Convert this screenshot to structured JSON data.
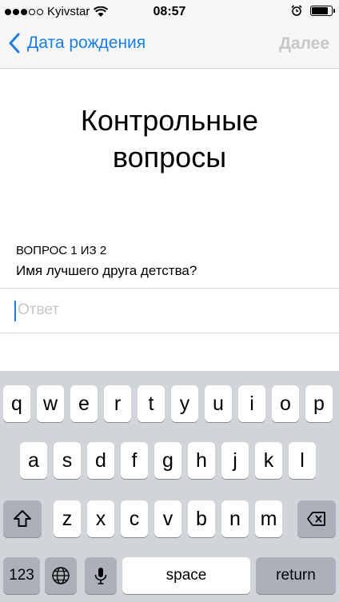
{
  "status_bar": {
    "carrier": "Kyivstar",
    "time": "08:57",
    "signal_bars_filled": 3,
    "signal_bars_total": 5,
    "battery_level": 0.85
  },
  "nav": {
    "back_label": "Дата рождения",
    "next_label": "Далее"
  },
  "content": {
    "title_line1": "Контрольные",
    "title_line2": "вопросы",
    "question_counter": "ВОПРОС 1 ИЗ 2",
    "question_text": "Имя лучшего друга детства?",
    "answer_value": "",
    "answer_placeholder": "Ответ"
  },
  "keyboard": {
    "row1": [
      "q",
      "w",
      "e",
      "r",
      "t",
      "y",
      "u",
      "i",
      "o",
      "p"
    ],
    "row2": [
      "a",
      "s",
      "d",
      "f",
      "g",
      "h",
      "j",
      "k",
      "l"
    ],
    "row3": [
      "z",
      "x",
      "c",
      "v",
      "b",
      "n",
      "m"
    ],
    "numbers_label": "123",
    "space_label": "space",
    "return_label": "return"
  },
  "colors": {
    "accent": "#1a7ee8",
    "disabled": "#c7c7cc",
    "keyboard_bg": "#d1d4d9",
    "key_dark": "#abb0ba"
  }
}
